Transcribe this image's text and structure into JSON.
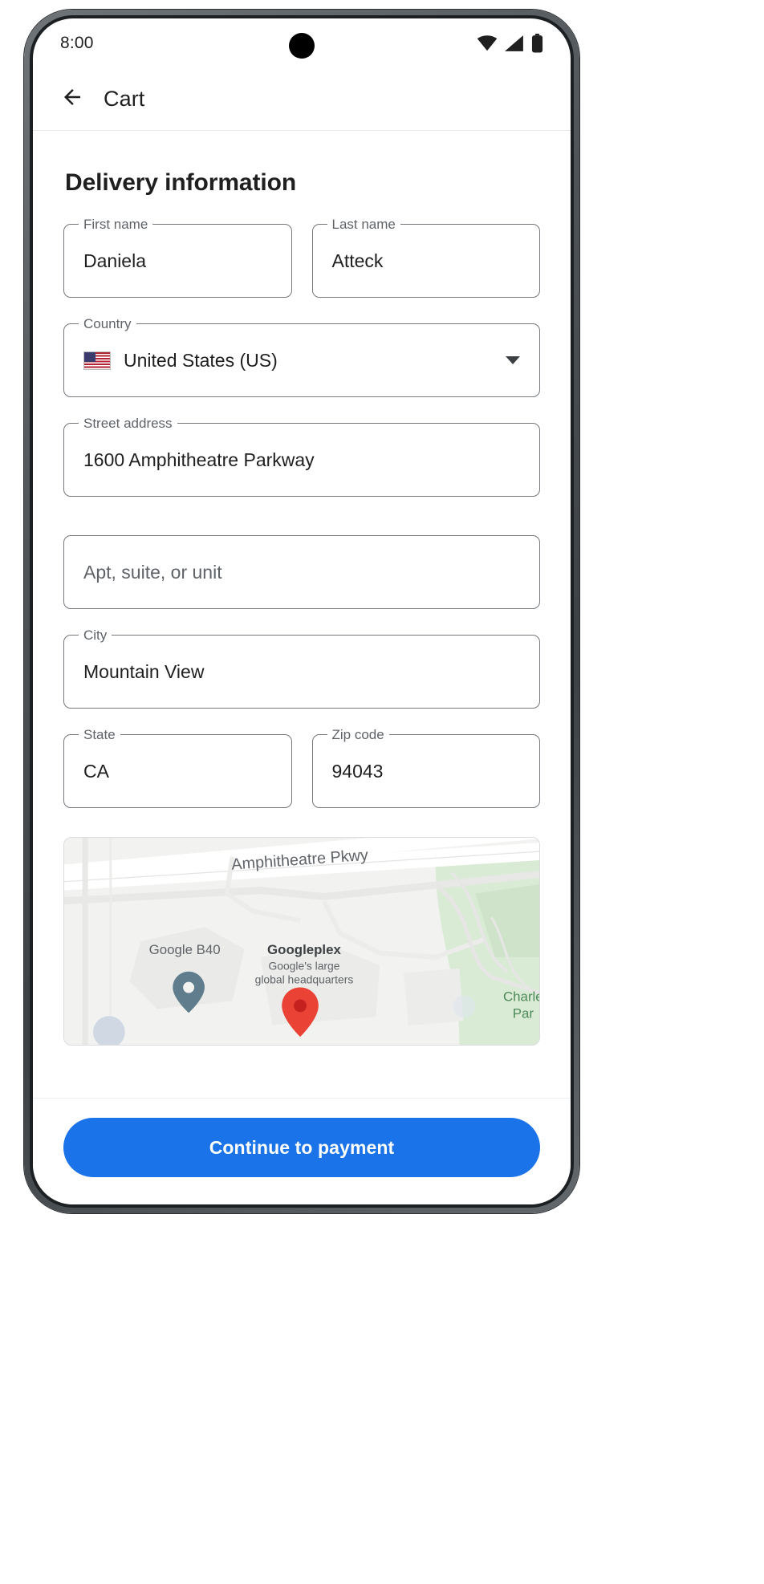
{
  "status_bar": {
    "time": "8:00",
    "icons": [
      "wifi-icon",
      "cellular-signal-icon",
      "battery-icon"
    ]
  },
  "app_bar": {
    "back_icon": "arrow-back-icon",
    "title": "Cart"
  },
  "section": {
    "title": "Delivery information"
  },
  "fields": {
    "first_name": {
      "label": "First name",
      "value": "Daniela"
    },
    "last_name": {
      "label": "Last name",
      "value": "Atteck"
    },
    "country": {
      "label": "Country",
      "value": "United States (US)",
      "flag": "🇺🇸",
      "arrow_icon": "chevron-down-icon"
    },
    "street_address": {
      "label": "Street address",
      "value": "1600 Amphitheatre Parkway"
    },
    "apt": {
      "label": "",
      "value": "",
      "placeholder": "Apt, suite, or unit"
    },
    "city": {
      "label": "City",
      "value": "Mountain View"
    },
    "state": {
      "label": "State",
      "value": "CA"
    },
    "zip": {
      "label": "Zip code",
      "value": "94043"
    }
  },
  "map": {
    "street_label": "Amphitheatre Pkwy",
    "poi_b40": "Google B40",
    "poi_googleplex": "Googleplex",
    "poi_googleplex_sub1": "Google's large",
    "poi_googleplex_sub2": "global headquarters",
    "poi_park1": "Charle",
    "poi_park2": "Par",
    "marker_icon": "map-pin-icon"
  },
  "bottom_bar": {
    "continue_label": "Continue to payment"
  },
  "colors": {
    "primary": "#1a73e8",
    "marker_red": "#ea4335",
    "outline": "#74787c",
    "label_gray": "#5f6368"
  }
}
